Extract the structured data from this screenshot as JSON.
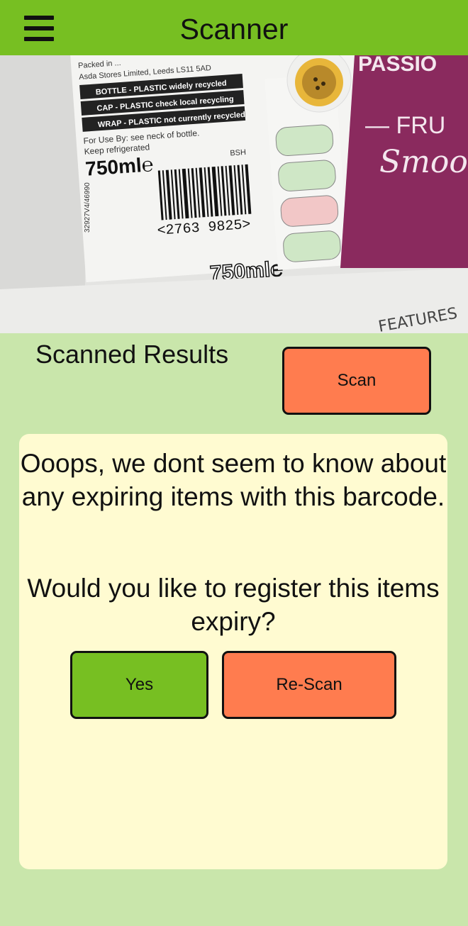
{
  "header": {
    "title": "Scanner",
    "menu_icon": "hamburger-menu-icon",
    "background": "#77bf22"
  },
  "camera": {
    "label_lines": [
      "Packed in ...",
      "Asda Stores Limited, Leeds LS11 5AD"
    ],
    "recycling": [
      "BOTTLE - PLASTIC widely recycled",
      "CAP - PLASTIC check local recycling",
      "WRAP - PLASTIC not currently recycled"
    ],
    "use_by": "For Use By: see neck of bottle.",
    "keep": "Keep refrigerated",
    "volume": "750ml℮",
    "volume_large": "750ml℮",
    "barcode_number": "<2763 9825>",
    "code_side": "32927V4/46990",
    "bsh": "BSH",
    "brand_partial": "PASSIO",
    "fruit_partial": "— FRU",
    "smoo_partial": "Smoo",
    "note": "FEATURES"
  },
  "results": {
    "title": "Scanned Results",
    "scan_button": "Scan"
  },
  "message": {
    "text": "Ooops, we dont seem to know about any expiring items with this barcode.",
    "question": "Would you like to register this items expiry?",
    "yes_button": "Yes",
    "rescan_button": "Re-Scan"
  },
  "colors": {
    "background": "#c9e6ab",
    "card": "#fffbd1",
    "accent_orange": "#ff7c4f",
    "accent_green": "#77bf22"
  }
}
